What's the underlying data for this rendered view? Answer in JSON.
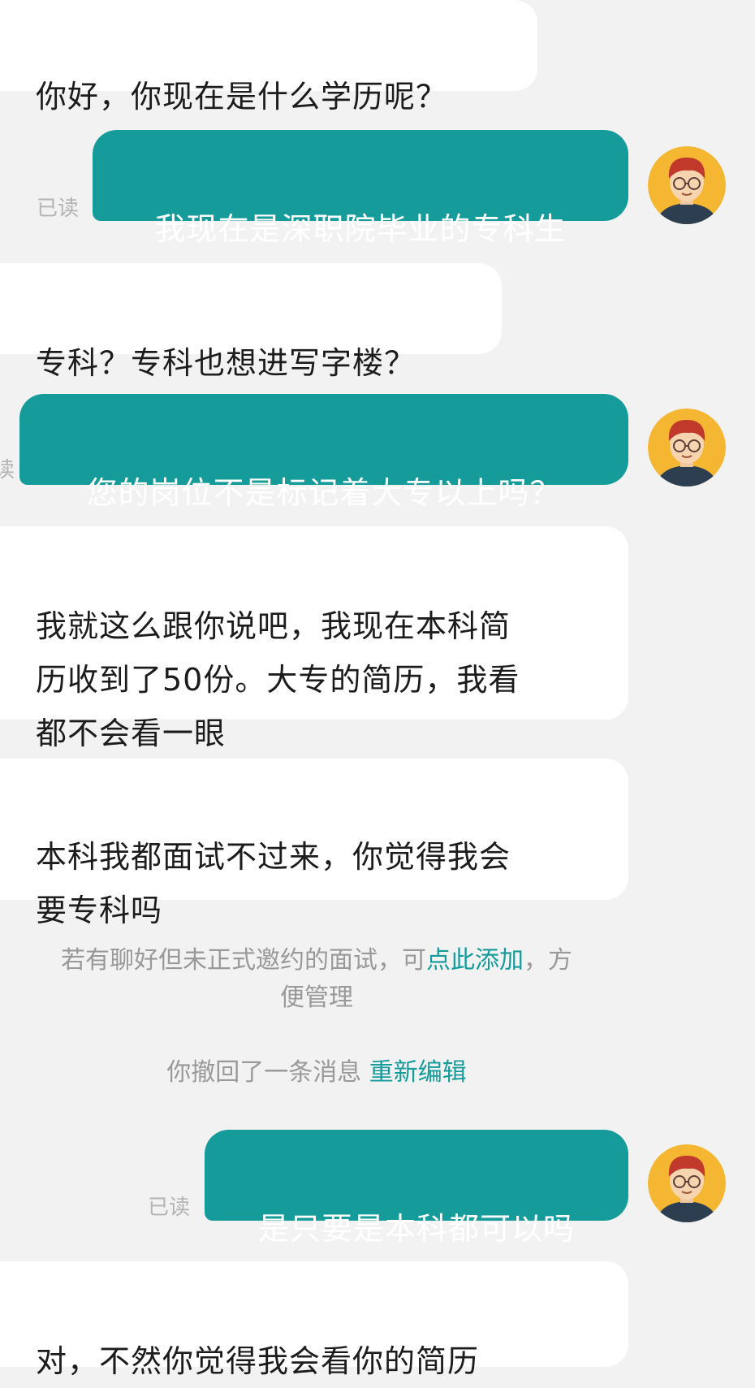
{
  "messages": [
    {
      "id": "m1",
      "side": "in",
      "text": "你好，你现在是什么学历呢？"
    },
    {
      "id": "m2",
      "side": "out",
      "text": "我现在是深职院毕业的专科生",
      "status": "已读"
    },
    {
      "id": "m3",
      "side": "in",
      "text": "专科？专科也想进写字楼？"
    },
    {
      "id": "m4",
      "side": "out",
      "text": "您的岗位不是标记着大专以上吗？",
      "status": "读"
    },
    {
      "id": "m5",
      "side": "in",
      "text": "我就这么跟你说吧，我现在本科简\n历收到了50份。大专的简历，我看\n都不会看一眼"
    },
    {
      "id": "m6",
      "side": "in",
      "text": "本科我都面试不过来，你觉得我会\n要专科吗"
    },
    {
      "id": "m7",
      "side": "out",
      "text": "是只要是本科都可以吗",
      "status": "已读"
    },
    {
      "id": "m8",
      "side": "in",
      "text": "对，不然你觉得我会看你的简历"
    }
  ],
  "interview_notice": {
    "prefix": "若有聊好但未正式邀约的面试，可",
    "link": "点此添加",
    "suffix": "，方\n便管理"
  },
  "recall_notice": {
    "text": "你撤回了一条消息",
    "link": "重新编辑"
  },
  "theme": {
    "accent": "#169b9b",
    "background": "#f2f2f2",
    "incoming_bubble": "#ffffff",
    "muted_text": "#999999"
  },
  "icons": {
    "avatar": "cartoon-man-with-glasses-avatar-icon"
  }
}
